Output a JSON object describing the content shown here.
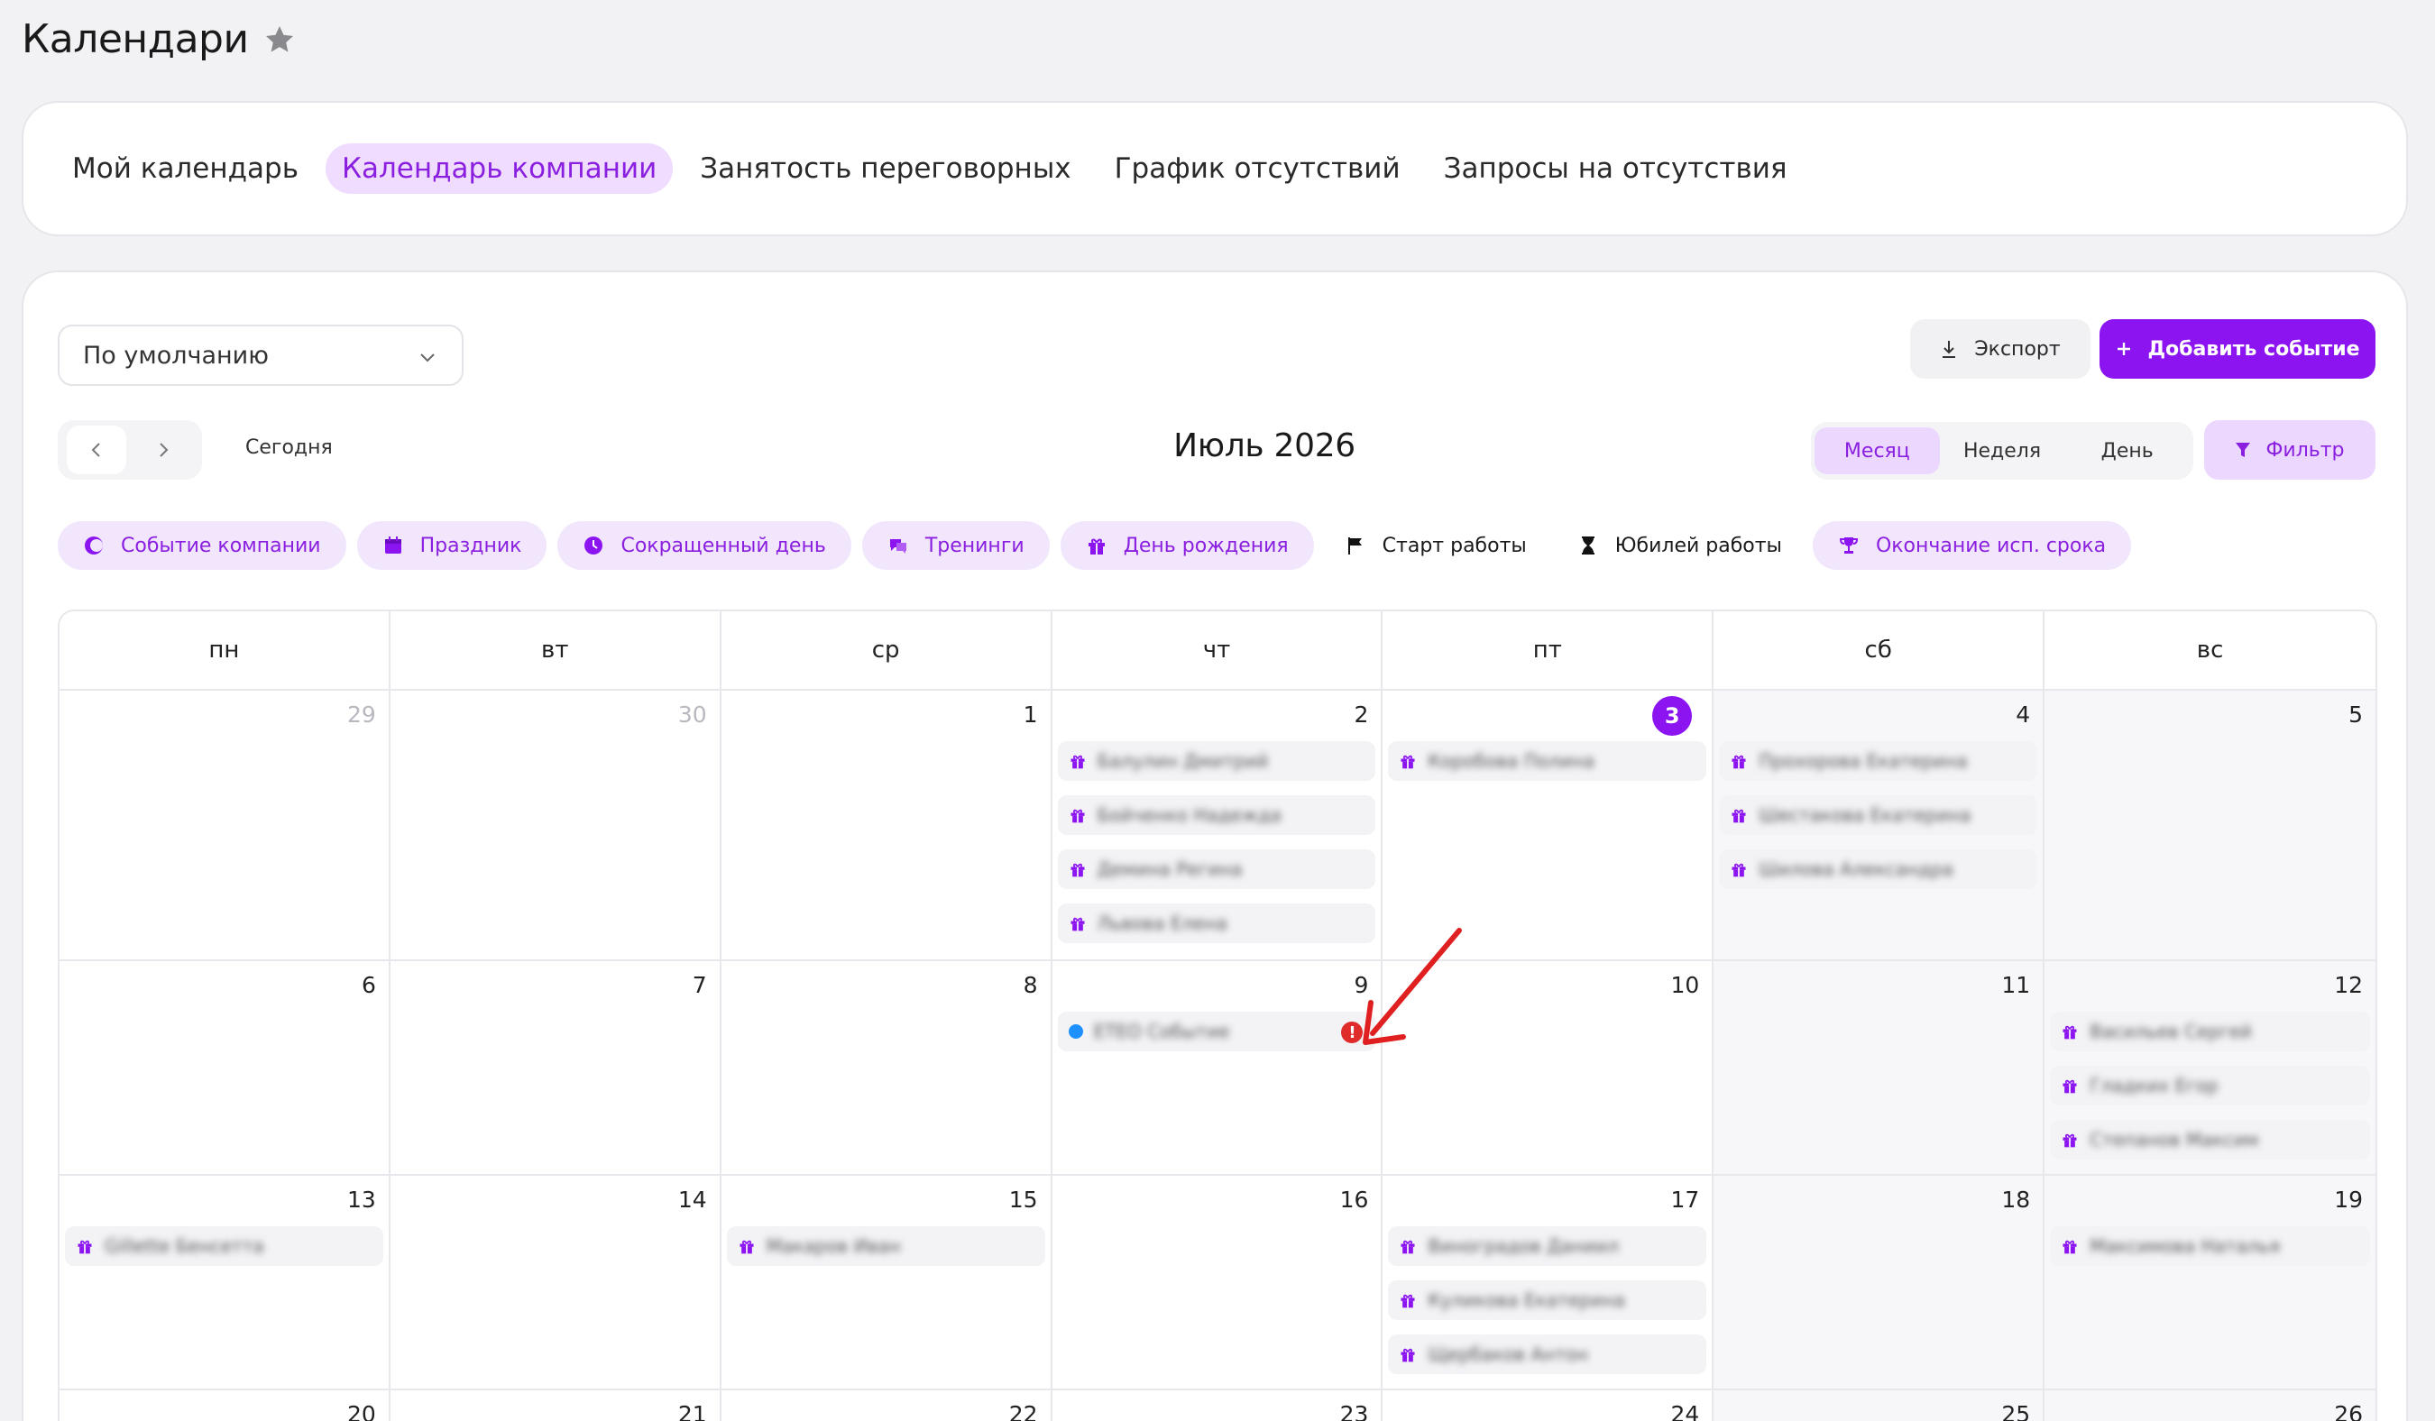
{
  "page": {
    "title": "Календари"
  },
  "tabs": [
    {
      "label": "Мой календарь",
      "active": false
    },
    {
      "label": "Календарь компании",
      "active": true
    },
    {
      "label": "Занятость переговорных",
      "active": false
    },
    {
      "label": "График отсутствий",
      "active": false
    },
    {
      "label": "Запросы на отсутствия",
      "active": false
    }
  ],
  "toolbar": {
    "view_select": "По умолчанию",
    "export_label": "Экспорт",
    "add_label": "Добавить событие",
    "today_label": "Сегодня",
    "month_title": "Июль 2026",
    "modes": [
      "Месяц",
      "Неделя",
      "День"
    ],
    "active_mode": "Месяц",
    "filter_label": "Фильтр"
  },
  "legend": [
    {
      "label": "Событие компании",
      "icon": "half-moon-icon",
      "style": "chip"
    },
    {
      "label": "Праздник",
      "icon": "calendar-icon",
      "style": "chip"
    },
    {
      "label": "Сокращенный день",
      "icon": "clock-icon",
      "style": "chip"
    },
    {
      "label": "Тренинги",
      "icon": "chat-icon",
      "style": "chip"
    },
    {
      "label": "День рождения",
      "icon": "gift-icon",
      "style": "chip"
    },
    {
      "label": "Старт работы",
      "icon": "flag-icon",
      "style": "plain"
    },
    {
      "label": "Юбилей работы",
      "icon": "hourglass-icon",
      "style": "plain"
    },
    {
      "label": "Окончание исп. срока",
      "icon": "trophy-icon",
      "style": "chip"
    }
  ],
  "weekdays": [
    "пн",
    "вт",
    "ср",
    "чт",
    "пт",
    "сб",
    "вс"
  ],
  "colors": {
    "accent": "#8b14f0",
    "accent_light": "#ecd8ff",
    "warning": "#e02b2b",
    "event_dot": "#1e90ff"
  },
  "weeks": [
    {
      "days": [
        {
          "num": "29",
          "muted": true,
          "events": []
        },
        {
          "num": "30",
          "muted": true,
          "events": []
        },
        {
          "num": "1",
          "events": []
        },
        {
          "num": "2",
          "events": [
            {
              "type": "birthday",
              "text": "Балулин Дмитрий"
            },
            {
              "type": "birthday",
              "text": "Бойченко Надежда"
            },
            {
              "type": "birthday",
              "text": "Демина Регина"
            },
            {
              "type": "birthday",
              "text": "Львова Елена"
            }
          ]
        },
        {
          "num": "3",
          "today": true,
          "events": [
            {
              "type": "birthday",
              "text": "Коробова Полина"
            }
          ]
        },
        {
          "num": "4",
          "weekend": true,
          "events": [
            {
              "type": "birthday",
              "text": "Прохорова Екатерина"
            },
            {
              "type": "birthday",
              "text": "Шестакова Екатерина"
            },
            {
              "type": "birthday",
              "text": "Шилова Александра"
            }
          ]
        },
        {
          "num": "5",
          "weekend": true,
          "events": []
        }
      ]
    },
    {
      "days": [
        {
          "num": "6",
          "events": []
        },
        {
          "num": "7",
          "events": []
        },
        {
          "num": "8",
          "events": []
        },
        {
          "num": "9",
          "events": [
            {
              "type": "company",
              "text": "ЕТЕО Событие",
              "warning": true
            }
          ]
        },
        {
          "num": "10",
          "events": []
        },
        {
          "num": "11",
          "weekend": true,
          "events": []
        },
        {
          "num": "12",
          "weekend": true,
          "events": [
            {
              "type": "birthday",
              "text": "Васильев Сергей"
            },
            {
              "type": "birthday",
              "text": "Гладких Егор"
            },
            {
              "type": "birthday",
              "text": "Степанов Максим"
            }
          ]
        }
      ]
    },
    {
      "days": [
        {
          "num": "13",
          "events": [
            {
              "type": "birthday",
              "text": "Gillette Бенсетта"
            }
          ]
        },
        {
          "num": "14",
          "events": []
        },
        {
          "num": "15",
          "events": [
            {
              "type": "birthday",
              "text": "Макаров Иван"
            }
          ]
        },
        {
          "num": "16",
          "events": []
        },
        {
          "num": "17",
          "events": [
            {
              "type": "birthday",
              "text": "Виноградов Даниил"
            },
            {
              "type": "birthday",
              "text": "Куликова Екатерина"
            },
            {
              "type": "birthday",
              "text": "Щербаков Антон"
            }
          ]
        },
        {
          "num": "18",
          "weekend": true,
          "events": []
        },
        {
          "num": "19",
          "weekend": true,
          "events": [
            {
              "type": "birthday",
              "text": "Максимова Наталья"
            }
          ]
        }
      ]
    },
    {
      "days": [
        {
          "num": "20",
          "events": []
        },
        {
          "num": "21",
          "events": []
        },
        {
          "num": "22",
          "events": []
        },
        {
          "num": "23",
          "events": []
        },
        {
          "num": "24",
          "events": []
        },
        {
          "num": "25",
          "weekend": true,
          "events": []
        },
        {
          "num": "26",
          "weekend": true,
          "events": []
        }
      ]
    }
  ]
}
